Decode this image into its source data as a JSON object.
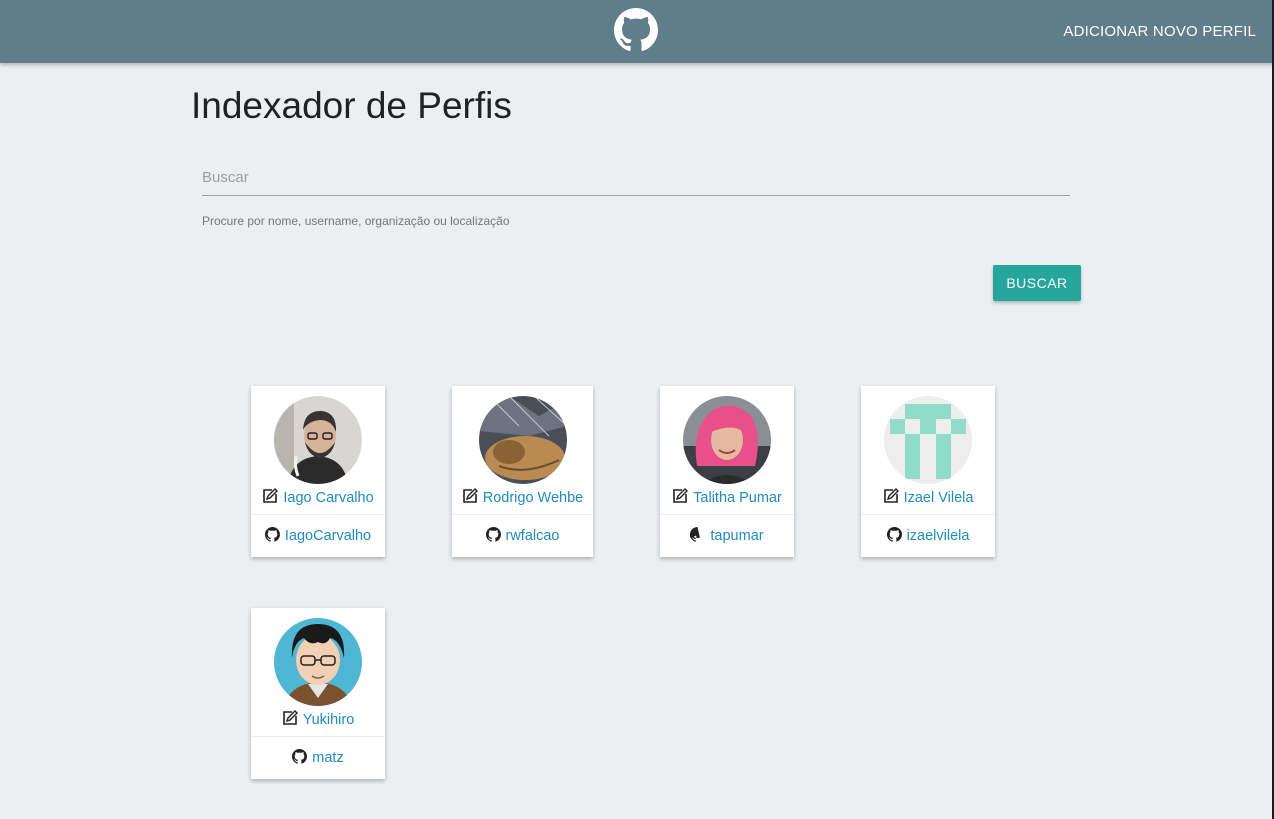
{
  "navbar": {
    "logo_icon": "github-icon",
    "add_profile_label": "ADICIONAR NOVO PERFIL",
    "background": "#607d8b"
  },
  "page": {
    "title": "Indexador de Perfis"
  },
  "search": {
    "placeholder": "Buscar",
    "value": "",
    "helper": "Procure por nome, username, organização ou localização",
    "button_label": "BUSCAR"
  },
  "accent": "#26a69a",
  "link_color": "#1f8cbf",
  "profiles": [
    {
      "name": "Iago Carvalho",
      "username": "IagoCarvalho"
    },
    {
      "name": "Rodrigo Wehbe",
      "username": "rwfalcao"
    },
    {
      "name": "Talitha Pumar",
      "username": "tapumar"
    },
    {
      "name": "Izael Vilela",
      "username": "izaelvilela"
    },
    {
      "name": "Yukihiro",
      "username": "matz"
    }
  ]
}
